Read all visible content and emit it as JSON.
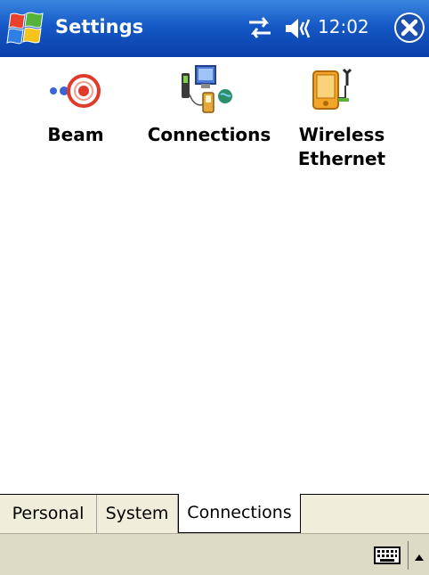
{
  "titlebar": {
    "title": "Settings",
    "clock": "12:02",
    "icons": [
      "windows-flag-icon",
      "connectivity-arrows-icon",
      "speaker-icon",
      "close-icon"
    ]
  },
  "items": [
    {
      "label": "Beam",
      "icon": "beam-icon"
    },
    {
      "label": "Connections",
      "icon": "connections-icon"
    },
    {
      "label_line1": "Wireless",
      "label_line2": "Ethernet",
      "icon": "wireless-ethernet-icon"
    }
  ],
  "tabs": [
    {
      "label": "Personal",
      "active": false
    },
    {
      "label": "System",
      "active": false
    },
    {
      "label": "Connections",
      "active": true
    }
  ],
  "commandbar": {
    "icons": [
      "keyboard-icon",
      "sip-arrow-icon"
    ]
  },
  "colors": {
    "titlebar": "#1559c6",
    "tabstrip": "#f0eedb",
    "commandbar": "#dddac6"
  }
}
